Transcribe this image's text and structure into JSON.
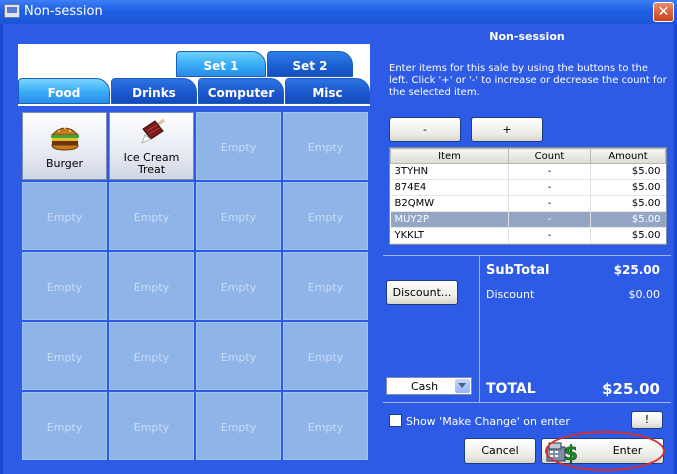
{
  "window": {
    "title": "Non-session",
    "close_glyph": "✕"
  },
  "tabs": {
    "sets": [
      {
        "label": "Set 1"
      },
      {
        "label": "Set 2"
      }
    ],
    "categories": [
      {
        "label": "Food"
      },
      {
        "label": "Drinks"
      },
      {
        "label": "Computer"
      },
      {
        "label": "Misc"
      }
    ]
  },
  "grid": {
    "cells": [
      {
        "label": "Burger",
        "icon": "burger-icon"
      },
      {
        "label": "Ice Cream Treat",
        "icon": "ice-cream-icon"
      },
      {
        "label": "Empty"
      },
      {
        "label": "Empty"
      },
      {
        "label": "Empty"
      },
      {
        "label": "Empty"
      },
      {
        "label": "Empty"
      },
      {
        "label": "Empty"
      },
      {
        "label": "Empty"
      },
      {
        "label": "Empty"
      },
      {
        "label": "Empty"
      },
      {
        "label": "Empty"
      },
      {
        "label": "Empty"
      },
      {
        "label": "Empty"
      },
      {
        "label": "Empty"
      },
      {
        "label": "Empty"
      },
      {
        "label": "Empty"
      },
      {
        "label": "Empty"
      },
      {
        "label": "Empty"
      },
      {
        "label": "Empty"
      }
    ]
  },
  "panel": {
    "title": "Non-session",
    "instructions": "Enter items for this sale by using the buttons to the left. Click '+' or '-' to increase or decrease the count for the selected item.",
    "minus_label": "-",
    "plus_label": "+"
  },
  "items_table": {
    "headers": [
      "Item",
      "Count",
      "Amount"
    ],
    "rows": [
      {
        "item": "3TYHN",
        "count": "-",
        "amount": "$5.00"
      },
      {
        "item": "874E4",
        "count": "-",
        "amount": "$5.00"
      },
      {
        "item": "B2QMW",
        "count": "-",
        "amount": "$5.00"
      },
      {
        "item": "MUY2P",
        "count": "-",
        "amount": "$5.00"
      },
      {
        "item": "YKKLT",
        "count": "-",
        "amount": "$5.00"
      }
    ]
  },
  "totals": {
    "subtotal_label": "SubTotal",
    "subtotal_value": "$25.00",
    "discount_label": "Discount",
    "discount_value": "$0.00",
    "total_label": "TOTAL",
    "total_value": "$25.00"
  },
  "controls": {
    "discount_button": "Discount...",
    "payment_method": "Cash",
    "make_change_label": "Show 'Make Change' on enter",
    "alert_button": "!",
    "cancel_button": "Cancel",
    "enter_button": "Enter"
  },
  "colors": {
    "window_blue": "#2d5be5",
    "tab_blue": "#3aaaf7",
    "empty_cell": "#8fb5e8",
    "highlight_oval": "#d43030"
  }
}
